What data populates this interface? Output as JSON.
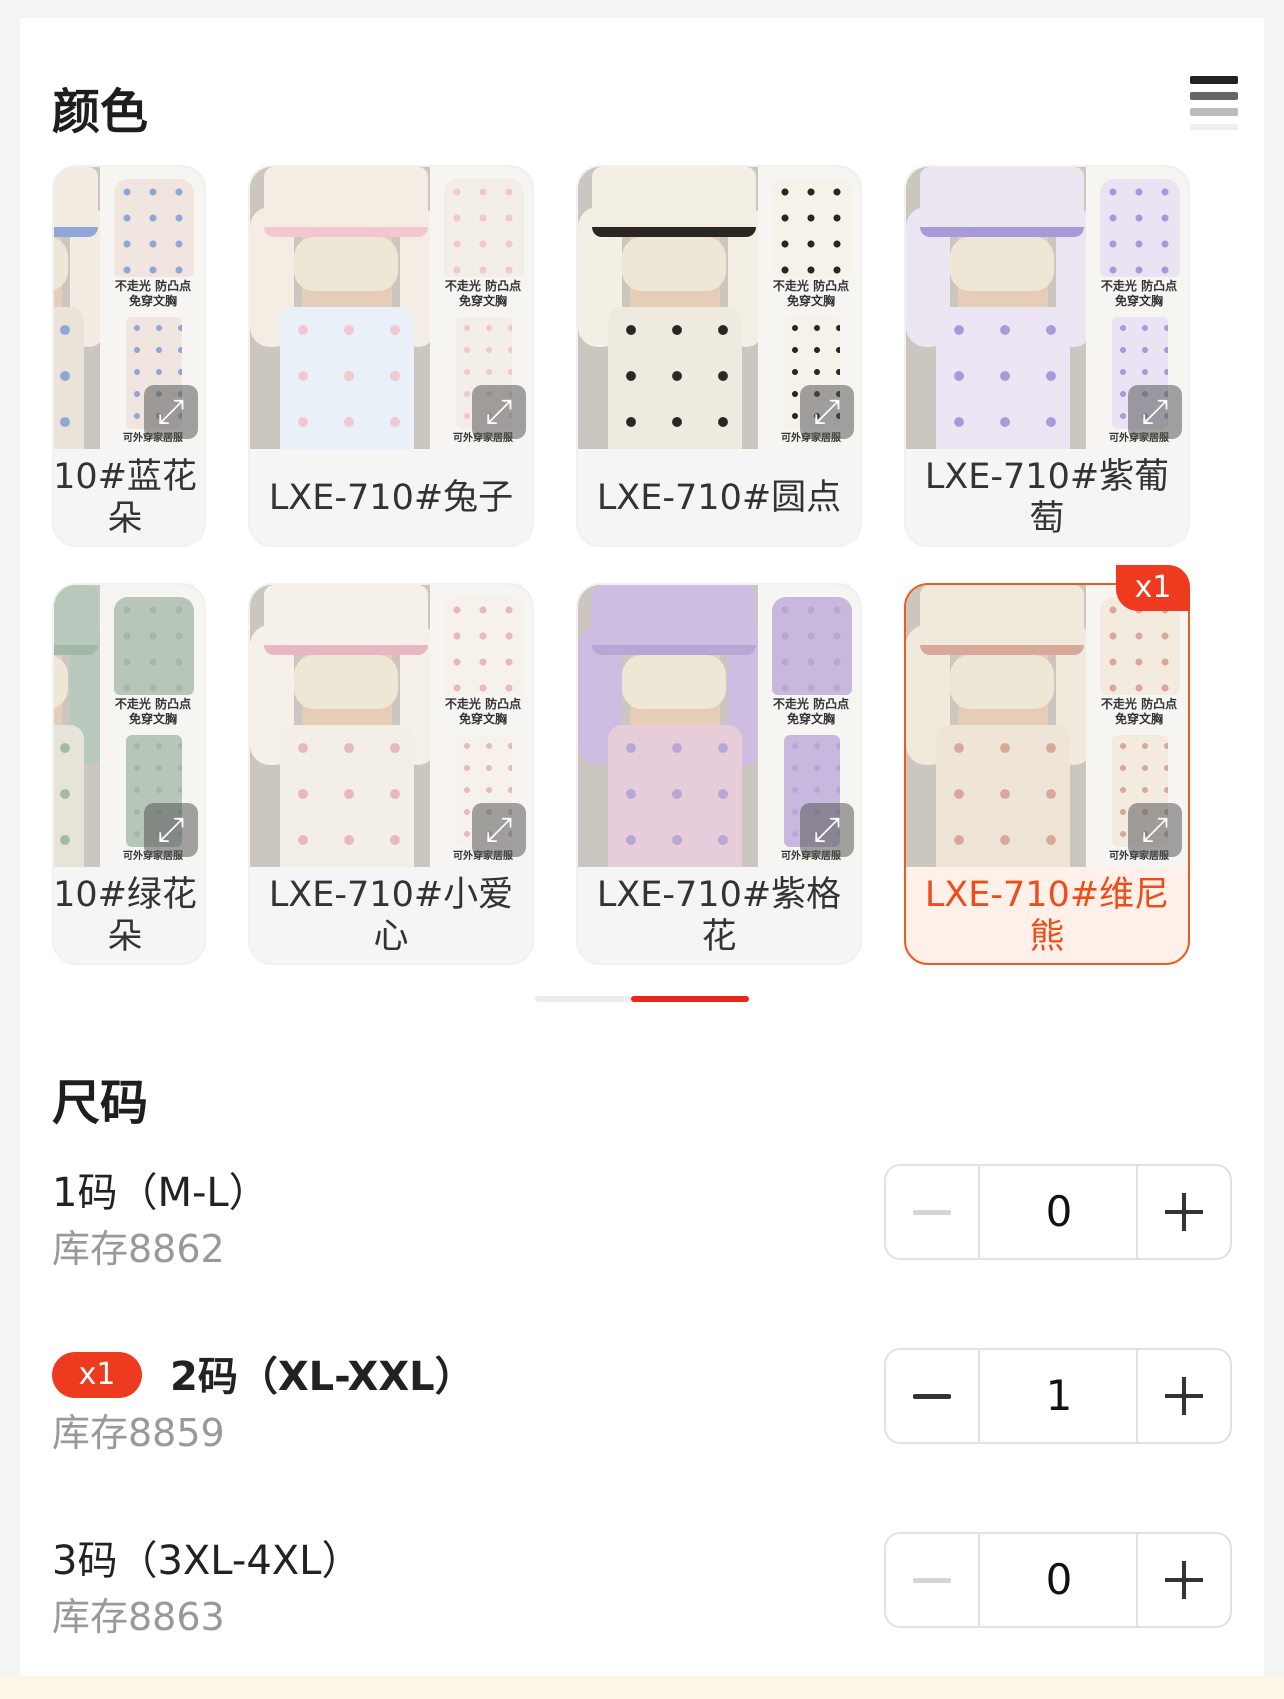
{
  "color_section": {
    "title": "颜色"
  },
  "colors": [
    {
      "label": "10#蓝花朵",
      "count": null,
      "palette": {
        "top": "#f2ece3",
        "accent": "#8fa6d6",
        "bottoms": "#e9e3da",
        "flat": "#f0e6df"
      }
    },
    {
      "label": "LXE-710#兔子",
      "count": null,
      "palette": {
        "top": "#f3ede4",
        "accent": "#f2c7cf",
        "bottoms": "#eaf0f7",
        "flat": "#f3eee8"
      }
    },
    {
      "label": "LXE-710#圆点",
      "count": null,
      "palette": {
        "top": "#f3efe4",
        "accent": "#2a2622",
        "bottoms": "#efeadf",
        "flat": "#f6f2ea"
      }
    },
    {
      "label": "LXE-710#紫葡萄",
      "count": null,
      "palette": {
        "top": "#ebe6f2",
        "accent": "#a89ad8",
        "bottoms": "#ece6f4",
        "flat": "#e9e3f3"
      }
    },
    {
      "label": "10#绿花朵",
      "count": null,
      "palette": {
        "top": "#b9c8bc",
        "accent": "#a3b8a8",
        "bottoms": "#e6e3d9",
        "flat": "#b7c6b8"
      }
    },
    {
      "label": "LXE-710#小爱心",
      "count": null,
      "palette": {
        "top": "#f5f0e8",
        "accent": "#e7b7c4",
        "bottoms": "#f3eee6",
        "flat": "#f6f1ea"
      }
    },
    {
      "label": "LXE-710#紫格花",
      "count": null,
      "palette": {
        "top": "#cdbde2",
        "accent": "#b7a6d6",
        "bottoms": "#e7cdd9",
        "flat": "#c8b8dd"
      }
    },
    {
      "label": "LXE-710#维尼熊",
      "count": "x1",
      "palette": {
        "top": "#f1e9dc",
        "accent": "#d8a89a",
        "bottoms": "#efe5d6",
        "flat": "#f3ebdf"
      }
    }
  ],
  "image_overlay": {
    "tag_line1": "不走光 防凸点",
    "tag_line2": "免穿文胸",
    "footer": "可外穿家居服",
    "expand_glyph": "⤢"
  },
  "size_section": {
    "title": "尺码"
  },
  "sizes": [
    {
      "name": "1码（M-L）",
      "stock": "库存8862",
      "qty": "0",
      "badge": null
    },
    {
      "name": "2码（XL-XXL）",
      "stock": "库存8859",
      "qty": "1",
      "badge": "x1"
    },
    {
      "name": "3码（3XL-4XL）",
      "stock": "库存8863",
      "qty": "0",
      "badge": null
    }
  ],
  "scroll_progress": 0.55,
  "colors_theme": {
    "accent": "#ee3b1f",
    "selected_bg": "#fff1ea"
  }
}
